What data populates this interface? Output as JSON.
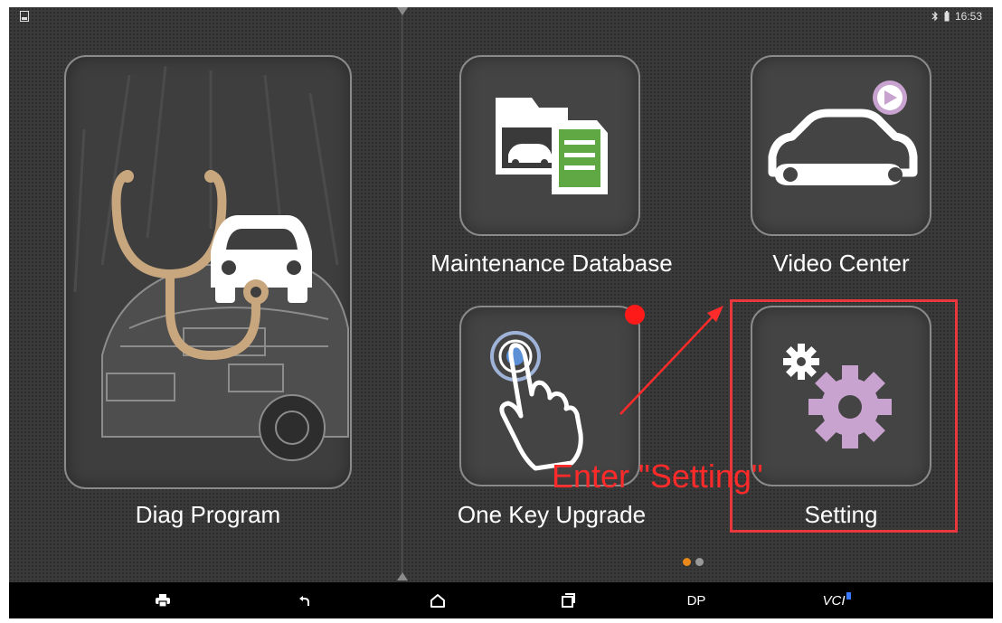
{
  "status_bar": {
    "time": "16:53",
    "left_icon": "screenshot-icon",
    "right_icons": [
      "bluetooth-icon",
      "battery-icon"
    ]
  },
  "tiles": {
    "diag": {
      "label": "Diag Program",
      "icon": "stethoscope-car-icon"
    },
    "maintenance": {
      "label": "Maintenance Database",
      "icon": "folder-document-car-icon"
    },
    "video": {
      "label": "Video Center",
      "icon": "car-wrench-play-icon"
    },
    "upgrade": {
      "label": "One Key Upgrade",
      "icon": "tap-hand-icon",
      "badge": "red-dot"
    },
    "setting": {
      "label": "Setting",
      "icon": "gears-icon"
    }
  },
  "annotation": {
    "text": "Enter \"Setting\"",
    "color": "#ff2a2a"
  },
  "pager": {
    "count": 2,
    "active": 1
  },
  "nav_bar": {
    "print_icon": "print-icon",
    "back_icon": "back-icon",
    "home_icon": "home-icon",
    "recent_icon": "recent-apps-icon",
    "dp_label": "DP",
    "vci_label": "VCI"
  },
  "colors": {
    "tile_border": "#8a8a8a",
    "highlight": "#e8383d",
    "active_dot": "#e8891a",
    "gear": "#c9a3cf"
  }
}
